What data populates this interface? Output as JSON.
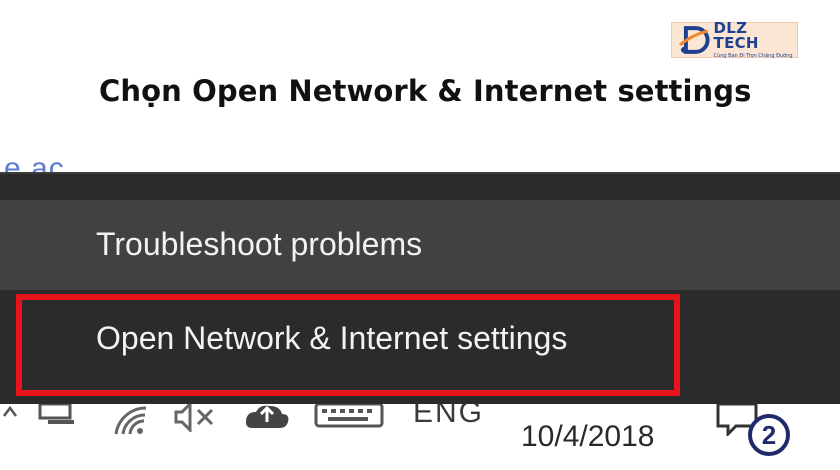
{
  "logo": {
    "name": "DLZ TECH",
    "tagline": "Cùng Bạn Đi Trọn Chặng Đường"
  },
  "heading": "Chọn Open Network & Internet settings",
  "peek_text": "e ac",
  "menu": {
    "items": [
      {
        "label": "Troubleshoot problems"
      },
      {
        "label": "Open Network & Internet settings"
      }
    ]
  },
  "taskbar": {
    "language": "ENG",
    "date": "10/4/2018",
    "notifications_count": "2",
    "icons": [
      "chevron-up-icon",
      "network-computer-icon",
      "wifi-icon",
      "volume-mute-icon",
      "onedrive-icon",
      "keyboard-icon",
      "action-center-icon"
    ]
  },
  "colors": {
    "menu_bg": "#2b2b2b",
    "menu_hover": "#414141",
    "highlight": "#e8141b",
    "logo_blue": "#1f3f91",
    "logo_bg": "#fbe6d4"
  }
}
